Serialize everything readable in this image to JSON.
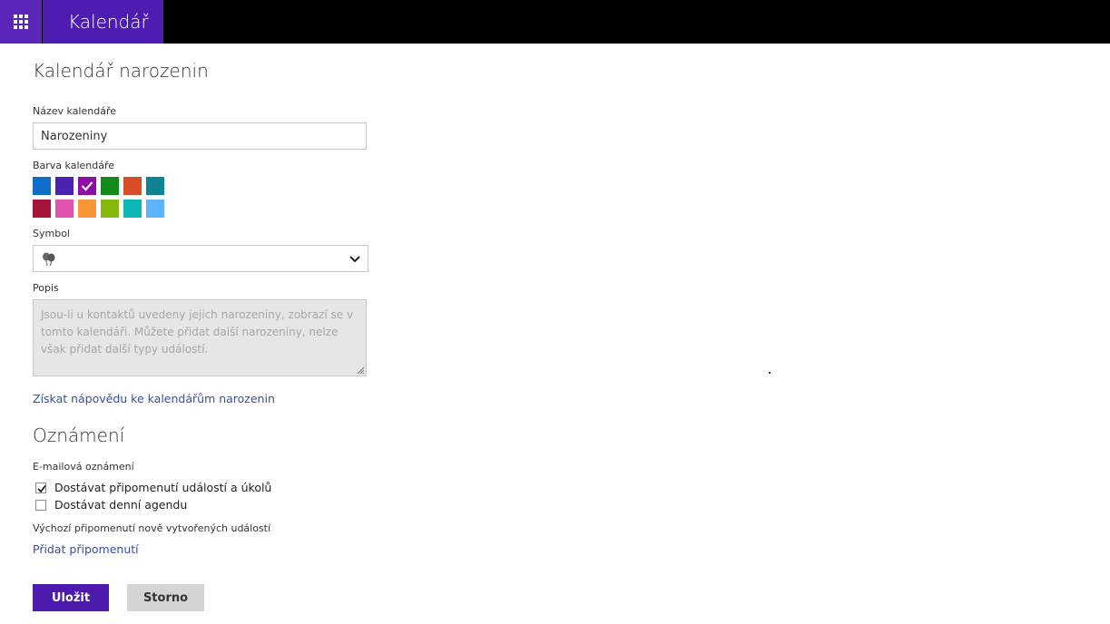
{
  "header": {
    "app_title": "Kalendář"
  },
  "form": {
    "page_title": "Kalendář narozenin",
    "name_label": "Název kalendáře",
    "name_value": "Narozeniny",
    "color_label": "Barva kalendáře",
    "colors": {
      "row1": [
        "#0f6fc6",
        "#4b22b2",
        "#8b0ea5",
        "#118a17",
        "#d64d27",
        "#0e8394"
      ],
      "row2": [
        "#a4143a",
        "#e052b2",
        "#fb9636",
        "#86b90c",
        "#0cb6b4",
        "#5cb4ff"
      ],
      "selected": "#8b0ea5"
    },
    "symbol_label": "Symbol",
    "symbol_icon": "balloons-icon",
    "description_label": "Popis",
    "description_text": "Jsou-li u kontaktů uvedeny jejich narozeniny, zobrazí se v tomto kalendáři. Můžete přidat další narozeniny, nelze však přidat další typy událostí.",
    "help_link": "Získat nápovědu ke kalendářům narozenin"
  },
  "notifications": {
    "title": "Oznámení",
    "email_label": "E-mailová oznámení",
    "reminders_label": "Dostávat připomenutí událostí a úkolů",
    "reminders_checked": true,
    "agenda_label": "Dostávat denní agendu",
    "agenda_checked": false,
    "default_reminder_label": "Výchozí připomenutí nově vytvořených událostí",
    "add_reminder_link": "Přidat připomenutí"
  },
  "actions": {
    "save_label": "Uložit",
    "cancel_label": "Storno"
  },
  "theme": {
    "accent": "#4c1bad",
    "link": "#3a4f9e"
  }
}
